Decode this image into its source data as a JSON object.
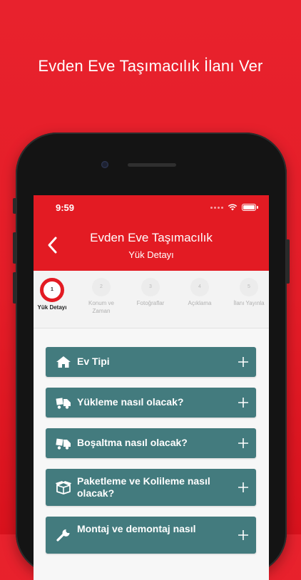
{
  "promo": {
    "title": "Evden Eve Taşımacılık İlanı Ver"
  },
  "status_bar": {
    "time": "9:59"
  },
  "header": {
    "title": "Evden Eve Taşımacılık",
    "subtitle": "Yük Detayı"
  },
  "steps": [
    {
      "number": "1",
      "label": "Yük Detayı",
      "active": true
    },
    {
      "number": "2",
      "label": "Konum ve\nZaman",
      "active": false
    },
    {
      "number": "3",
      "label": "Fotoğraflar",
      "active": false
    },
    {
      "number": "4",
      "label": "Açıklama",
      "active": false
    },
    {
      "number": "5",
      "label": "İlanı Yayınla",
      "active": false
    }
  ],
  "sections": [
    {
      "icon": "home-icon",
      "label": "Ev Tipi"
    },
    {
      "icon": "truck-icon",
      "label": "Yükleme nasıl olacak?"
    },
    {
      "icon": "truck-icon",
      "label": "Boşaltma nasıl olacak?"
    },
    {
      "icon": "box-icon",
      "label": "Paketleme ve Kolileme nasıl olacak?"
    },
    {
      "icon": "wrench-icon",
      "label": "Montaj ve demontaj nasıl"
    }
  ],
  "colors": {
    "brand_red": "#e31b23",
    "card_teal": "#437b7e"
  }
}
